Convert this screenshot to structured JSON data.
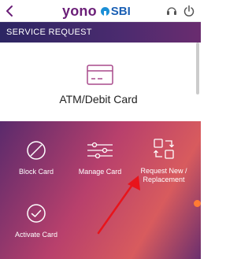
{
  "app": {
    "brand_yono": "yono",
    "brand_sbi": "SBI"
  },
  "header": {
    "title": "SERVICE REQUEST"
  },
  "card": {
    "title": "ATM/Debit Card"
  },
  "options": {
    "block": "Block Card",
    "manage": "Manage Card",
    "request_line1": "Request New /",
    "request_line2": "Replacement",
    "activate": "Activate Card"
  },
  "colors": {
    "brand_purple": "#6b1f78",
    "accent_orange": "#ff7b33",
    "arrow_red": "#e8141b"
  }
}
